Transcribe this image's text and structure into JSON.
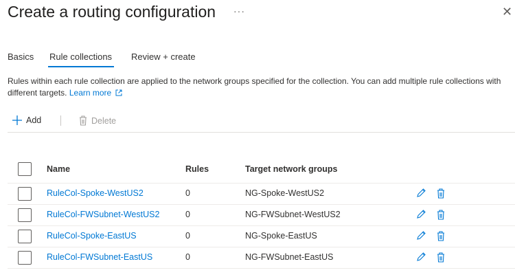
{
  "header": {
    "title": "Create a routing configuration",
    "more_label": "···",
    "close_label": "✕"
  },
  "tabs": [
    {
      "label": "Basics"
    },
    {
      "label": "Rule collections",
      "active": true
    },
    {
      "label": "Review + create"
    }
  ],
  "description": {
    "text": "Rules within each rule collection are applied to the network groups specified for the collection. You can add multiple rule collections with different targets.",
    "learn_more": "Learn more"
  },
  "toolbar": {
    "add_label": "Add",
    "delete_label": "Delete"
  },
  "table": {
    "columns": [
      "Name",
      "Rules",
      "Target network groups"
    ],
    "rows": [
      {
        "name": "RuleCol-Spoke-WestUS2",
        "rules": "0",
        "target": "NG-Spoke-WestUS2"
      },
      {
        "name": "RuleCol-FWSubnet-WestUS2",
        "rules": "0",
        "target": "NG-FWSubnet-WestUS2"
      },
      {
        "name": "RuleCol-Spoke-EastUS",
        "rules": "0",
        "target": "NG-Spoke-EastUS"
      },
      {
        "name": "RuleCol-FWSubnet-EastUS",
        "rules": "0",
        "target": "NG-FWSubnet-EastUS"
      }
    ]
  },
  "colors": {
    "accent": "#0078d4"
  }
}
